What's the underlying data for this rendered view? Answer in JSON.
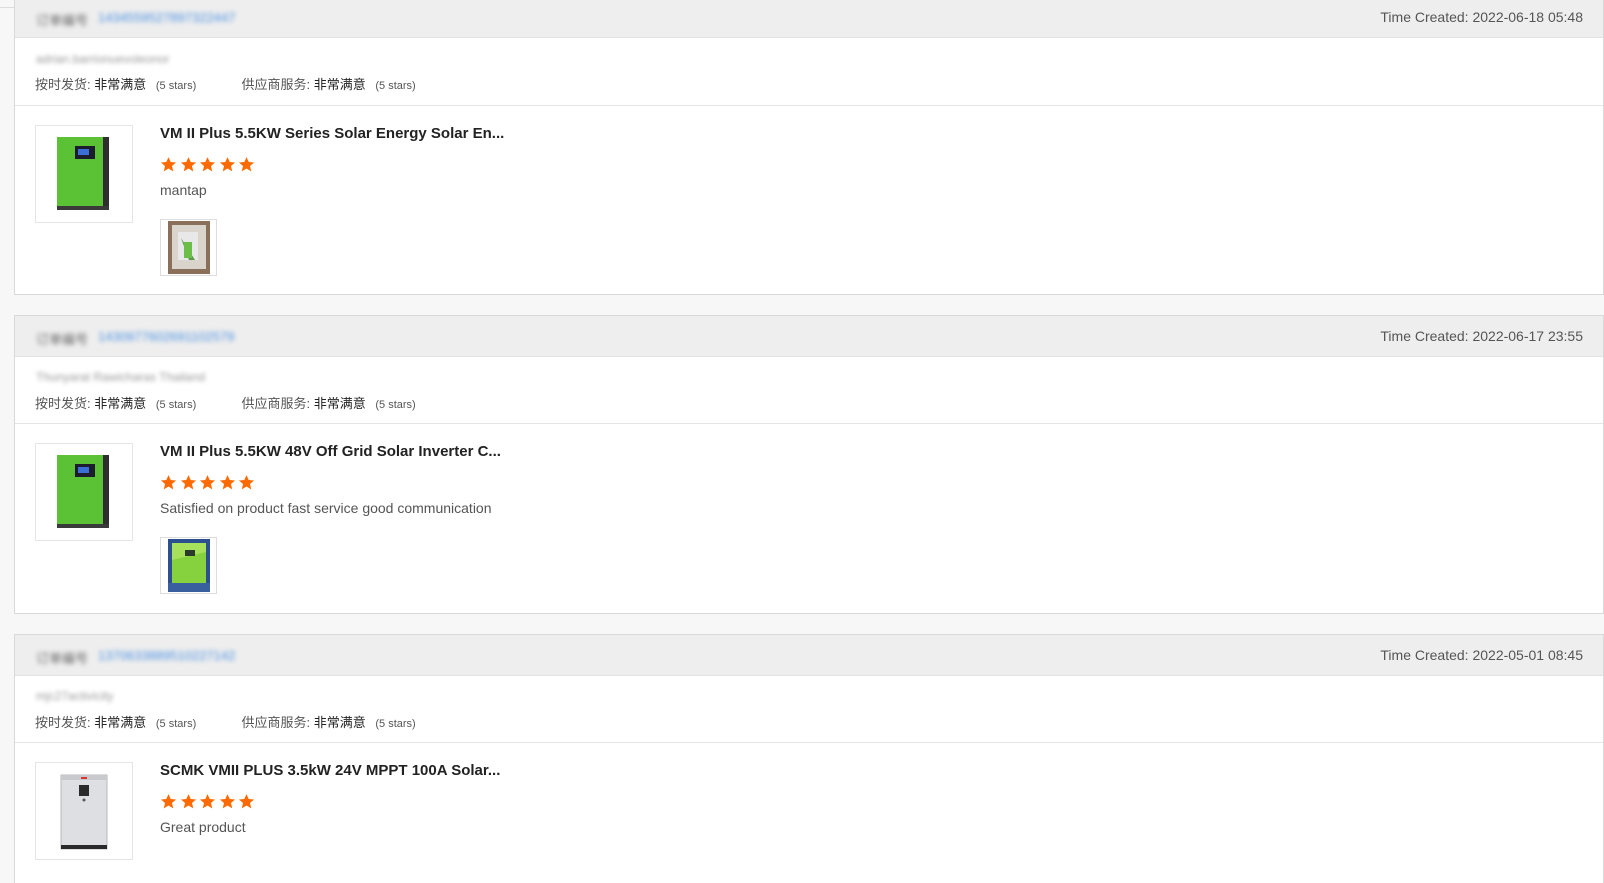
{
  "reviews": [
    {
      "order_label": "订单编号",
      "order_no": "1434559527897322447",
      "time_created": "Time Created: 2022-06-18 05:48",
      "buyer": "adrian.barrionuevoleonor",
      "ontime_label": "按时发货:",
      "ontime_value": "非常满意",
      "ontime_stars": "(5 stars)",
      "service_label": "供应商服务:",
      "service_value": "非常满意",
      "service_stars": "(5 stars)",
      "product_title": "VM II Plus 5.5KW Series Solar Energy Solar En...",
      "product_icon": "inverter-green-icon",
      "rating": 5,
      "comment": "mantap",
      "photo_icon": "photo-boxed-inverter-icon"
    },
    {
      "order_label": "订单编号",
      "order_no": "1430977602691102579",
      "time_created": "Time Created: 2022-06-17 23:55",
      "buyer": "Thunyarat Rawicharas Thailand",
      "ontime_label": "按时发货:",
      "ontime_value": "非常满意",
      "ontime_stars": "(5 stars)",
      "service_label": "供应商服务:",
      "service_value": "非常满意",
      "service_stars": "(5 stars)",
      "product_title": "VM II Plus 5.5KW 48V Off Grid Solar Inverter C...",
      "product_icon": "inverter-green-icon",
      "rating": 5,
      "comment": "Satisfied on product fast service good communication",
      "photo_icon": "photo-green-inverter-icon"
    },
    {
      "order_label": "订单编号",
      "order_no": "1370633889510227142",
      "time_created": "Time Created: 2022-05-01 08:45",
      "buyer": "mjc27activicity",
      "ontime_label": "按时发货:",
      "ontime_value": "非常满意",
      "ontime_stars": "(5 stars)",
      "service_label": "供应商服务:",
      "service_value": "非常满意",
      "service_stars": "(5 stars)",
      "product_title": "SCMK VMII PLUS 3.5kW 24V MPPT 100A Solar...",
      "product_icon": "inverter-white-icon",
      "rating": 5,
      "comment": "Great product",
      "photo_icon": ""
    }
  ],
  "colors": {
    "star": "#ff6a00",
    "link": "#4a90e2",
    "header_bg": "#eeeeee",
    "inverter_green": "#5bc236"
  }
}
